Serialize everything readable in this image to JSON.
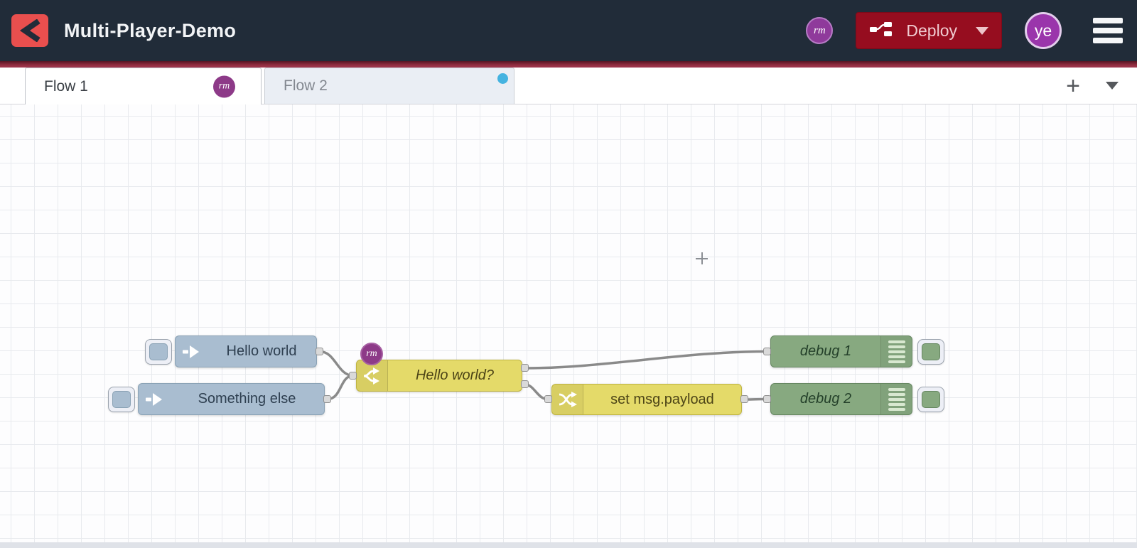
{
  "header": {
    "title": "Multi-Player-Demo",
    "collaborator_avatar": "rm",
    "deploy": {
      "label": "Deploy"
    },
    "user_avatar": "ye"
  },
  "tabbar": {
    "tabs": [
      {
        "label": "Flow 1",
        "active": true,
        "badge": "rm"
      },
      {
        "label": "Flow 2",
        "active": false,
        "unsaved": true
      }
    ],
    "add_label": "+"
  },
  "canvas": {
    "nodes": [
      {
        "id": "inject-hello-world",
        "type": "inject",
        "label": "Hello world"
      },
      {
        "id": "inject-something-else",
        "type": "inject",
        "label": "Something else"
      },
      {
        "id": "switch-hello-world",
        "type": "switch",
        "label": "Hello world?",
        "badge": "rm",
        "outputs": 2
      },
      {
        "id": "change-set-payload",
        "type": "change",
        "label": "set msg.payload"
      },
      {
        "id": "debug-1",
        "type": "debug",
        "label": "debug 1"
      },
      {
        "id": "debug-2",
        "type": "debug",
        "label": "debug 2"
      }
    ],
    "wires": [
      {
        "from": "inject-hello-world",
        "to": "switch-hello-world"
      },
      {
        "from": "inject-something-else",
        "to": "switch-hello-world"
      },
      {
        "from": "switch-hello-world:0",
        "to": "debug-1"
      },
      {
        "from": "switch-hello-world:1",
        "to": "change-set-payload"
      },
      {
        "from": "change-set-payload",
        "to": "debug-2"
      }
    ]
  },
  "colors": {
    "header_bg": "#212c39",
    "logo_red": "#e94f4e",
    "deploy_red": "#960d1f",
    "accent_line": "#8e2b3e",
    "avatar_purple": "#9a35ab",
    "badge_purple": "#8d3a88",
    "unsaved_dot_blue": "#45b3e0",
    "inject_fill": "#a9bdd0",
    "function_yellow": "#e4da69",
    "debug_green": "#87a980",
    "wire_gray": "#8a8a8a"
  }
}
